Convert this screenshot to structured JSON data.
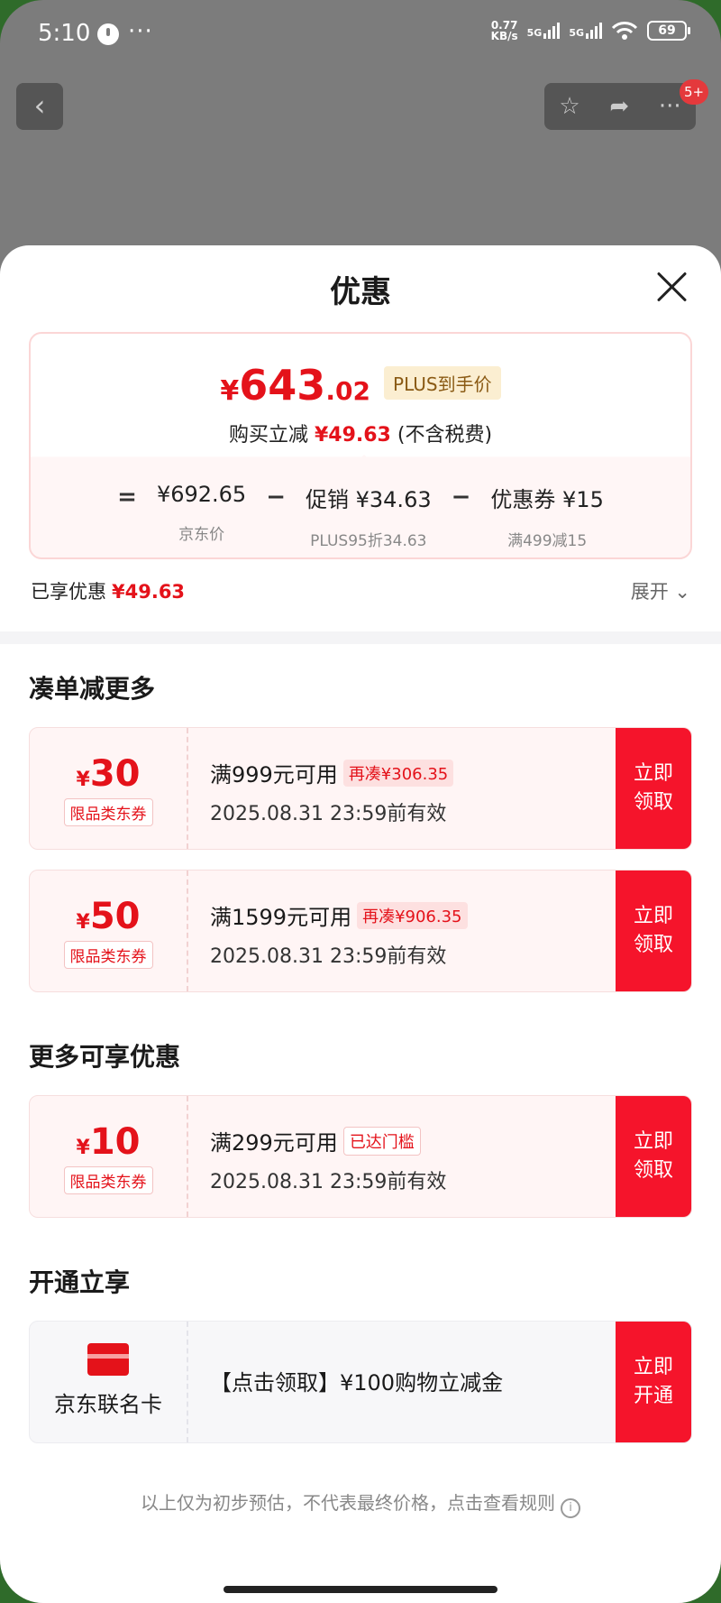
{
  "status_bar": {
    "time": "5:10",
    "more": "···",
    "net_speed_value": "0.77",
    "net_speed_unit": "KB/s",
    "sim1": "5G",
    "sim2": "5G",
    "battery": "69"
  },
  "nav": {
    "back": "‹",
    "star": "☆",
    "share": "➦",
    "more": "···",
    "badge": "5+"
  },
  "sheet": {
    "title": "优惠",
    "price": {
      "currency": "¥",
      "integer": "643",
      "decimal": ".02",
      "tag": "PLUS到手价",
      "save_prefix": "购买立减",
      "save_amount": "¥49.63",
      "save_suffix": "(不含税费)"
    },
    "formula": {
      "eq": "=",
      "minus1": "−",
      "minus2": "−",
      "items": [
        {
          "value": "¥692.65",
          "label": "京东价"
        },
        {
          "value": "促销 ¥34.63",
          "label": "PLUS95折34.63"
        },
        {
          "value": "优惠券 ¥15",
          "label": "满499减15"
        }
      ]
    },
    "enjoyed_label": "已享优惠",
    "enjoyed_amount": "¥49.63",
    "expand_label": "展开 ⌄"
  },
  "sections": {
    "more_discount_title": "凑单减更多",
    "more_available_title": "更多可享优惠",
    "activate_title": "开通立享"
  },
  "coupons": [
    {
      "currency": "¥",
      "amount": "30",
      "tag": "限品类东券",
      "condition": "满999元可用",
      "extra": "再凑¥306.35",
      "date": "2025.08.31 23:59前有效",
      "button": "立即领取"
    },
    {
      "currency": "¥",
      "amount": "50",
      "tag": "限品类东券",
      "condition": "满1599元可用",
      "extra": "再凑¥906.35",
      "date": "2025.08.31 23:59前有效",
      "button": "立即领取"
    },
    {
      "currency": "¥",
      "amount": "10",
      "tag": "限品类东券",
      "condition": "满299元可用",
      "extra": "已达门槛",
      "date": "2025.08.31 23:59前有效",
      "button": "立即领取"
    }
  ],
  "card_offer": {
    "name": "京东联名卡",
    "description": "【点击领取】¥100购物立减金",
    "button": "立即开通"
  },
  "footnote": "以上仅为初步预估，不代表最终价格，点击查看规则",
  "info_icon": "i"
}
